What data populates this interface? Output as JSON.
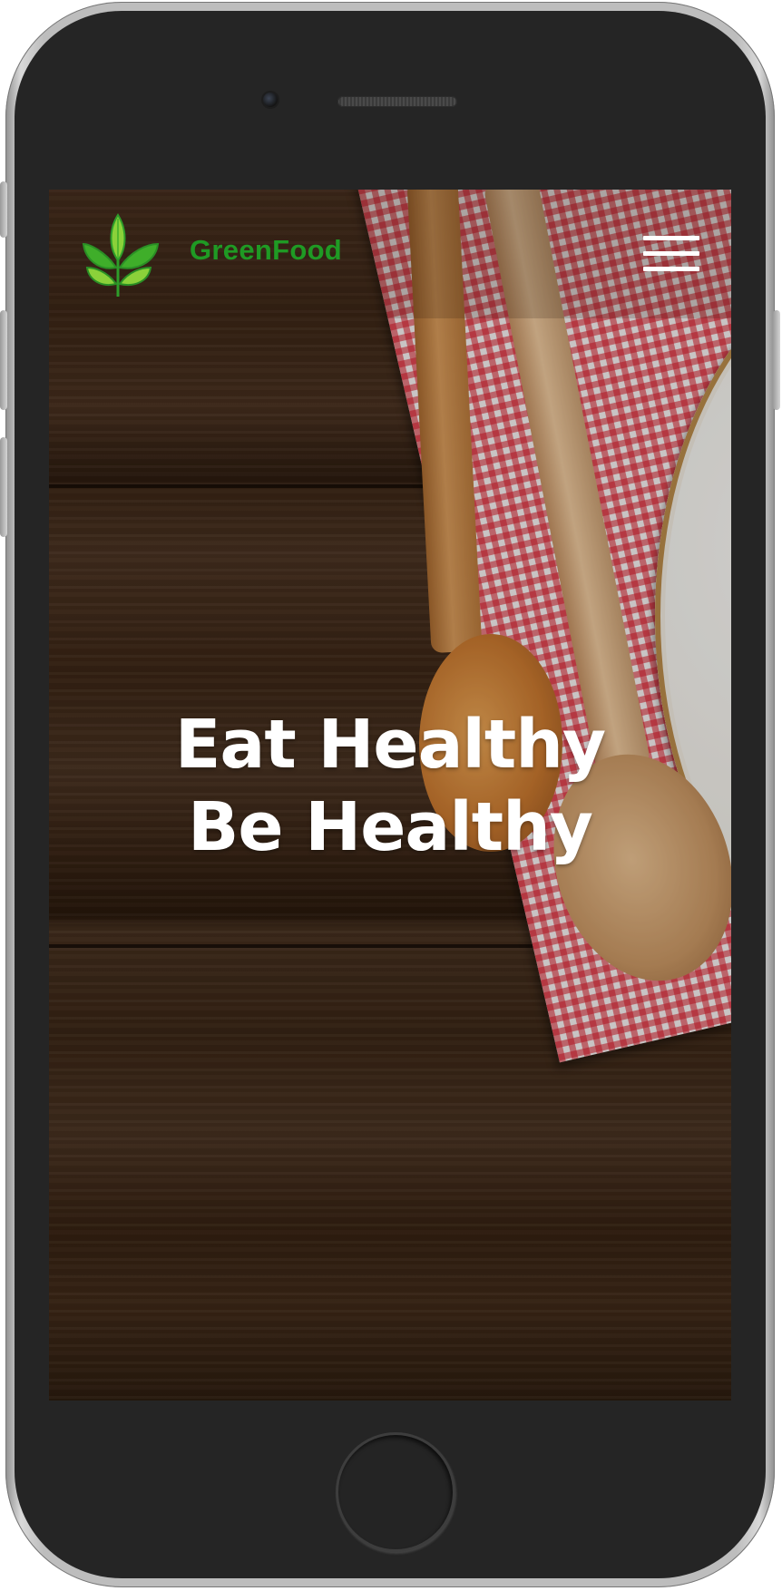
{
  "brand": {
    "name": "GreenFood",
    "logo_icon": "leaf-sprout-icon",
    "name_color": "#1f9a24"
  },
  "nav": {
    "menu_icon": "hamburger-menu-icon"
  },
  "hero": {
    "line1": "Eat Healthy",
    "line2": "Be Healthy",
    "background": "wooden table with red gingham napkin, wooden spoons and white plate"
  },
  "colors": {
    "leaf_green": "#3fae2a",
    "leaf_light": "#8bd13a",
    "hero_text": "#ffffff",
    "device_body": "#252525"
  }
}
